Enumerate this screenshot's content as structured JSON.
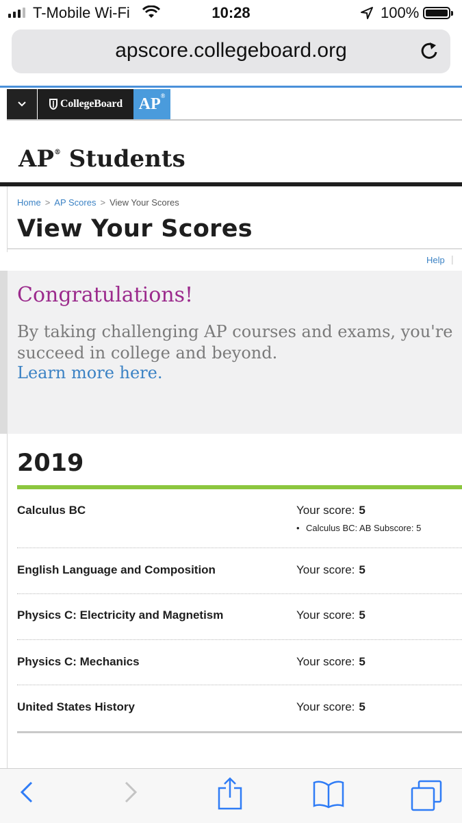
{
  "status_bar": {
    "carrier": "T-Mobile Wi-Fi",
    "time": "10:28",
    "battery": "100%"
  },
  "browser": {
    "url": "apscore.collegeboard.org"
  },
  "brand": {
    "collegeboard": "CollegeBoard",
    "ap_badge": "AP",
    "registered": "®",
    "site_title": "AP",
    "site_title_rest": " Students"
  },
  "breadcrumb": {
    "home": "Home",
    "ap_scores": "AP Scores",
    "current": "View Your Scores",
    "separator": ">"
  },
  "page": {
    "title": "View Your Scores",
    "help": "Help",
    "help_sep": "|"
  },
  "congrats": {
    "title": "Congratulations!",
    "body_line1": "By taking challenging AP courses and exams, you're",
    "body_line2": "succeed in college and beyond.",
    "link": "Learn more here."
  },
  "scores": {
    "year": "2019",
    "score_label": "Your score:",
    "rows": [
      {
        "exam": "Calculus BC",
        "score": "5",
        "subscore": "Calculus BC: AB Subscore: 5"
      },
      {
        "exam": "English Language and Composition",
        "score": "5"
      },
      {
        "exam": "Physics C: Electricity and Magnetism",
        "score": "5"
      },
      {
        "exam": "Physics C: Mechanics",
        "score": "5"
      },
      {
        "exam": "United States History",
        "score": "5"
      }
    ]
  },
  "colors": {
    "ap_blue": "#4a9bdc",
    "congrats_purple": "#9b2a8c",
    "link_blue": "#3b82c4",
    "year_green": "#8cc63f"
  },
  "icons": [
    "wifi-icon",
    "location-arrow-icon",
    "battery-icon",
    "reload-icon",
    "chevron-down-icon",
    "acorn-icon",
    "back-icon",
    "forward-icon",
    "share-icon",
    "bookmarks-icon",
    "tabs-icon"
  ]
}
